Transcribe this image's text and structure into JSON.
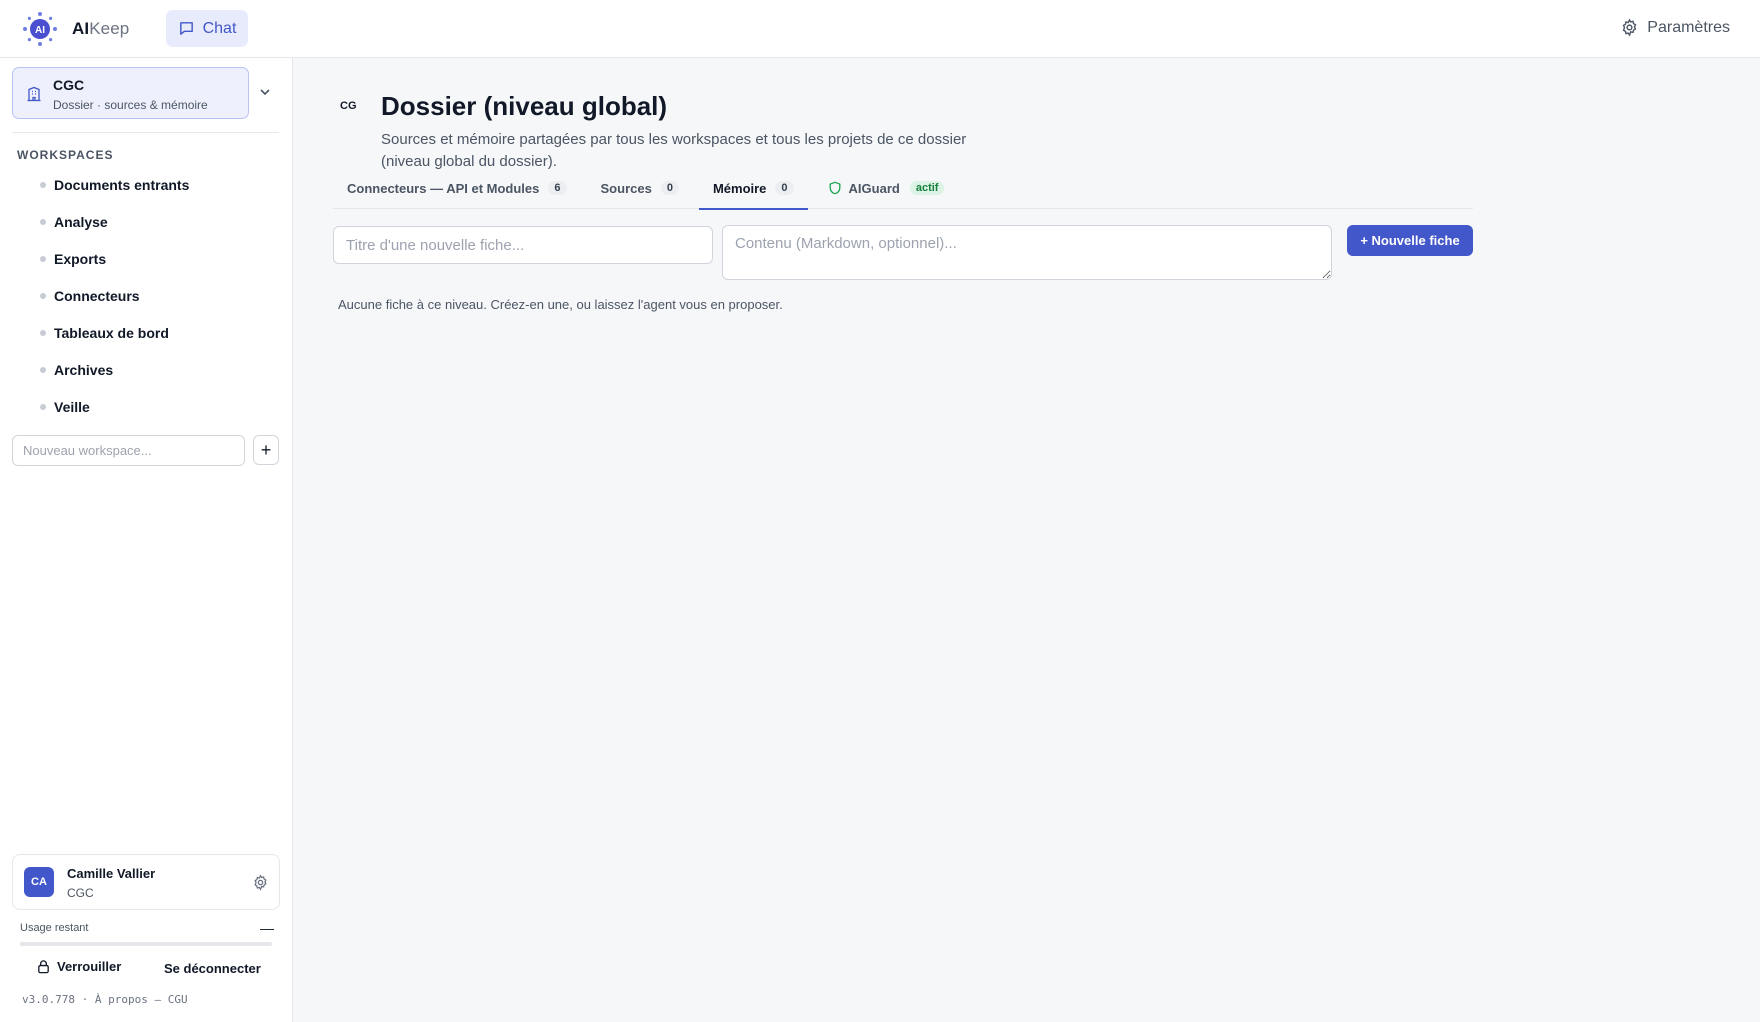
{
  "app": {
    "logo_mark": "AI",
    "name_bold": "AI",
    "name_rest": "Keep",
    "accent_color": "#4257c9"
  },
  "topbar": {
    "chat_label": "Chat",
    "settings_label": "Paramètres"
  },
  "sidebar": {
    "folder": {
      "title": "CGC",
      "subtitle": "Dossier · sources & mémoire"
    },
    "workspaces_heading": "WORKSPACES",
    "workspaces": [
      "Documents entrants",
      "Analyse",
      "Exports",
      "Connecteurs",
      "Tableaux de bord",
      "Archives",
      "Veille"
    ],
    "new_workspace_placeholder": "Nouveau workspace...",
    "add_label": "+"
  },
  "user": {
    "initials": "CA",
    "name": "Camille Vallier",
    "org": "CGC",
    "usage_label": "Usage restant",
    "usage_value": "—",
    "usage_fraction": 0,
    "lock_label": "Verrouiller",
    "logout_label": "Se déconnecter",
    "version": "v3.0.778",
    "sep": "·",
    "about": "À propos",
    "dash": "—",
    "terms": "CGU"
  },
  "main": {
    "scope_badge": "CG",
    "title": "Dossier (niveau global)",
    "description": "Sources et mémoire partagées par tous les workspaces et tous les projets de ce dossier (niveau global du dossier).",
    "tabs": [
      {
        "label": "Connecteurs — API et Modules",
        "count": "6"
      },
      {
        "label": "Sources",
        "count": "0"
      },
      {
        "label": "Mémoire",
        "count": "0",
        "active": true
      },
      {
        "label": "AIGuard",
        "pill": "actif",
        "icon": "shield-icon"
      }
    ],
    "fiche_title_placeholder": "Titre d'une nouvelle fiche...",
    "fiche_content_placeholder": "Contenu (Markdown, optionnel)...",
    "new_fiche_label": "+ Nouvelle fiche",
    "empty_message": "Aucune fiche à ce niveau. Créez-en une, ou laissez l'agent vous en proposer."
  }
}
